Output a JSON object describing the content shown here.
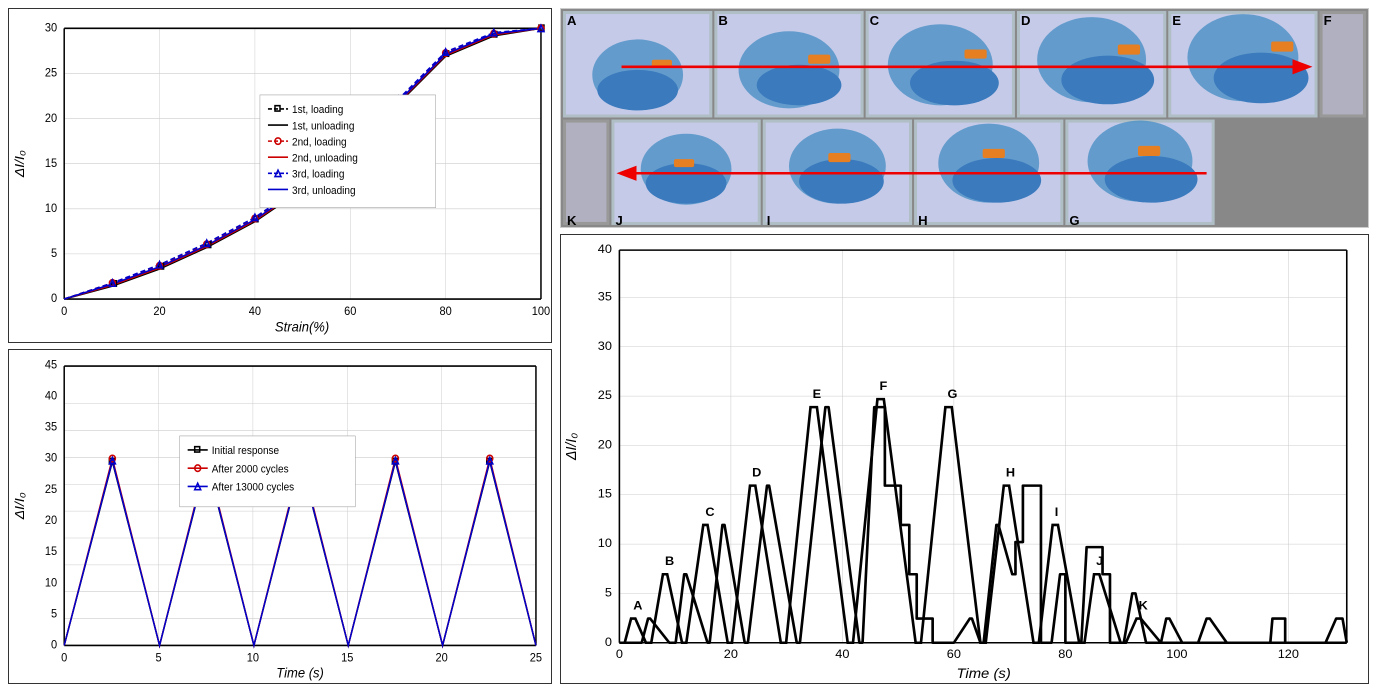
{
  "charts": {
    "top_left": {
      "title": "",
      "x_axis_label": "Strain(%)",
      "y_axis_label": "ΔI/I₀",
      "x_min": 0,
      "x_max": 100,
      "y_min": 0,
      "y_max": 30,
      "x_ticks": [
        0,
        20,
        40,
        60,
        80,
        100
      ],
      "y_ticks": [
        0,
        5,
        10,
        15,
        20,
        25,
        30
      ],
      "legend": [
        {
          "label": "1st, loading",
          "color": "#000",
          "style": "dashed",
          "marker": "square"
        },
        {
          "label": "1st, unloading",
          "color": "#000",
          "style": "solid",
          "marker": "none"
        },
        {
          "label": "2nd, loading",
          "color": "#e00",
          "style": "dashed",
          "marker": "circle"
        },
        {
          "label": "2nd, unloading",
          "color": "#e00",
          "style": "solid",
          "marker": "none"
        },
        {
          "label": "3rd, loading",
          "color": "#00e",
          "style": "dashed",
          "marker": "triangle"
        },
        {
          "label": "3rd, unloading",
          "color": "#00e",
          "style": "solid",
          "marker": "none"
        }
      ]
    },
    "bottom_left": {
      "x_axis_label": "Time (s)",
      "y_axis_label": "ΔI/I₀",
      "x_min": 0,
      "x_max": 25,
      "y_min": 0,
      "y_max": 45,
      "x_ticks": [
        0,
        5,
        10,
        15,
        20,
        25
      ],
      "y_ticks": [
        0,
        5,
        10,
        15,
        20,
        25,
        30,
        35,
        40,
        45
      ],
      "legend": [
        {
          "label": "Initial response",
          "color": "#000",
          "style": "solid",
          "marker": "square"
        },
        {
          "label": "After 2000 cycles",
          "color": "#e00",
          "style": "solid",
          "marker": "circle"
        },
        {
          "label": "After 13000 cycles",
          "color": "#00e",
          "style": "solid",
          "marker": "triangle"
        }
      ]
    },
    "bottom_right": {
      "x_axis_label": "Time (s)",
      "y_axis_label": "ΔI/I₀",
      "x_min": 0,
      "x_max": 130,
      "y_min": 0,
      "y_max": 40,
      "x_ticks": [
        0,
        20,
        40,
        60,
        80,
        100,
        120
      ],
      "y_ticks": [
        0,
        5,
        10,
        15,
        20,
        25,
        30,
        35,
        40
      ],
      "point_labels": [
        "A",
        "B",
        "C",
        "D",
        "E",
        "F",
        "G",
        "H",
        "I",
        "J",
        "K"
      ]
    }
  },
  "image_section": {
    "labels_top": [
      "A",
      "B",
      "C",
      "D",
      "E",
      "F"
    ],
    "labels_bottom": [
      "K",
      "J",
      "I",
      "H",
      "G"
    ],
    "arrow_direction_top": "right",
    "arrow_direction_bottom": "left"
  }
}
